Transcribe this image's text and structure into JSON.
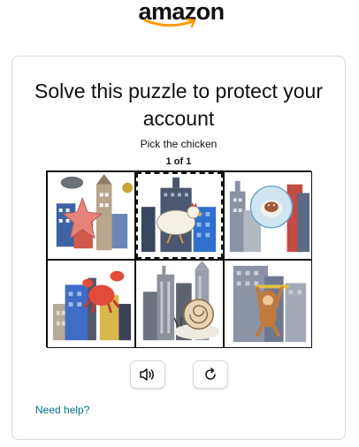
{
  "logo": {
    "text": "amazon"
  },
  "puzzle": {
    "title": "Solve this puzzle to protect your account",
    "instruction": "Pick the chicken",
    "counter": "1 of 1",
    "selected_tile": 2,
    "tiles": [
      {
        "subject": "starfish-in-city"
      },
      {
        "subject": "chicken-in-city"
      },
      {
        "subject": "sheep-in-city"
      },
      {
        "subject": "crab-in-city"
      },
      {
        "subject": "snail-in-city"
      },
      {
        "subject": "monkey-in-city"
      }
    ]
  },
  "controls": {
    "audio_icon": "speaker-icon",
    "reload_icon": "reload-icon"
  },
  "help": {
    "link_text": "Need help?"
  },
  "colors": {
    "link": "#007185",
    "brand_orange": "#ff9900",
    "border": "#d5d9d9"
  }
}
